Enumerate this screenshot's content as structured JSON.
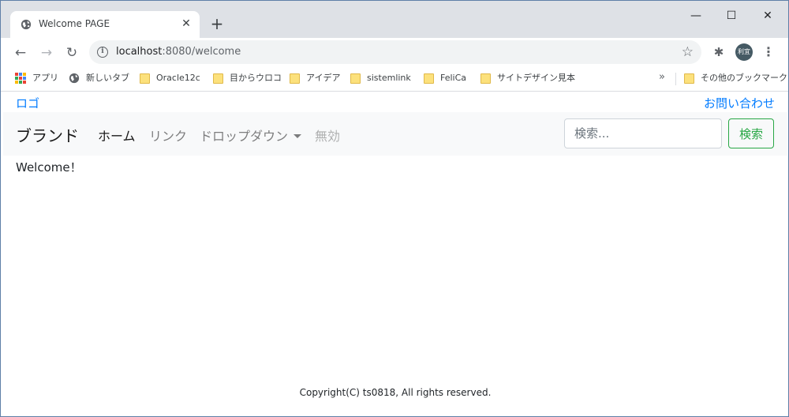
{
  "browser": {
    "tab_title": "Welcome PAGE",
    "tab_close": "✕",
    "new_tab": "+",
    "minimize": "—",
    "maximize": "☐",
    "close": "✕",
    "url_host": "localhost",
    "url_rest": ":8080/welcome",
    "avatar_text": "利宜",
    "back_icon": "←",
    "forward_icon": "→",
    "reload_icon": "↻",
    "star_icon": "☆",
    "extension_icon": "✱",
    "menu_icon": "⋮"
  },
  "bookmarks": {
    "items": [
      {
        "label": "アプリ",
        "icon": "apps-grid-icon"
      },
      {
        "label": "新しいタブ",
        "icon": "globe-icon"
      },
      {
        "label": "Oracle12c",
        "icon": "folder-icon"
      },
      {
        "label": "目からウロコ",
        "icon": "folder-icon"
      },
      {
        "label": "アイデア",
        "icon": "folder-icon"
      },
      {
        "label": "sistemlink",
        "icon": "folder-icon"
      },
      {
        "label": "FeliCa",
        "icon": "folder-icon"
      },
      {
        "label": "サイトデザイン見本",
        "icon": "folder-icon"
      }
    ],
    "more": "»",
    "other": "その他のブックマーク"
  },
  "page": {
    "logo": "ロゴ",
    "contact": "お問い合わせ",
    "navbar": {
      "brand": "ブランド",
      "home": "ホーム",
      "link": "リンク",
      "dropdown": "ドロップダウン",
      "disabled": "無効",
      "search_placeholder": "検索...",
      "search_button": "検索"
    },
    "welcome": "Welcome！",
    "footer": "Copyright(C) ts0818, All rights reserved."
  },
  "colors": {
    "link": "#007bff",
    "success": "#28a745",
    "navbar_bg": "#f8f9fa",
    "tabstrip_bg": "#dee1e6"
  }
}
